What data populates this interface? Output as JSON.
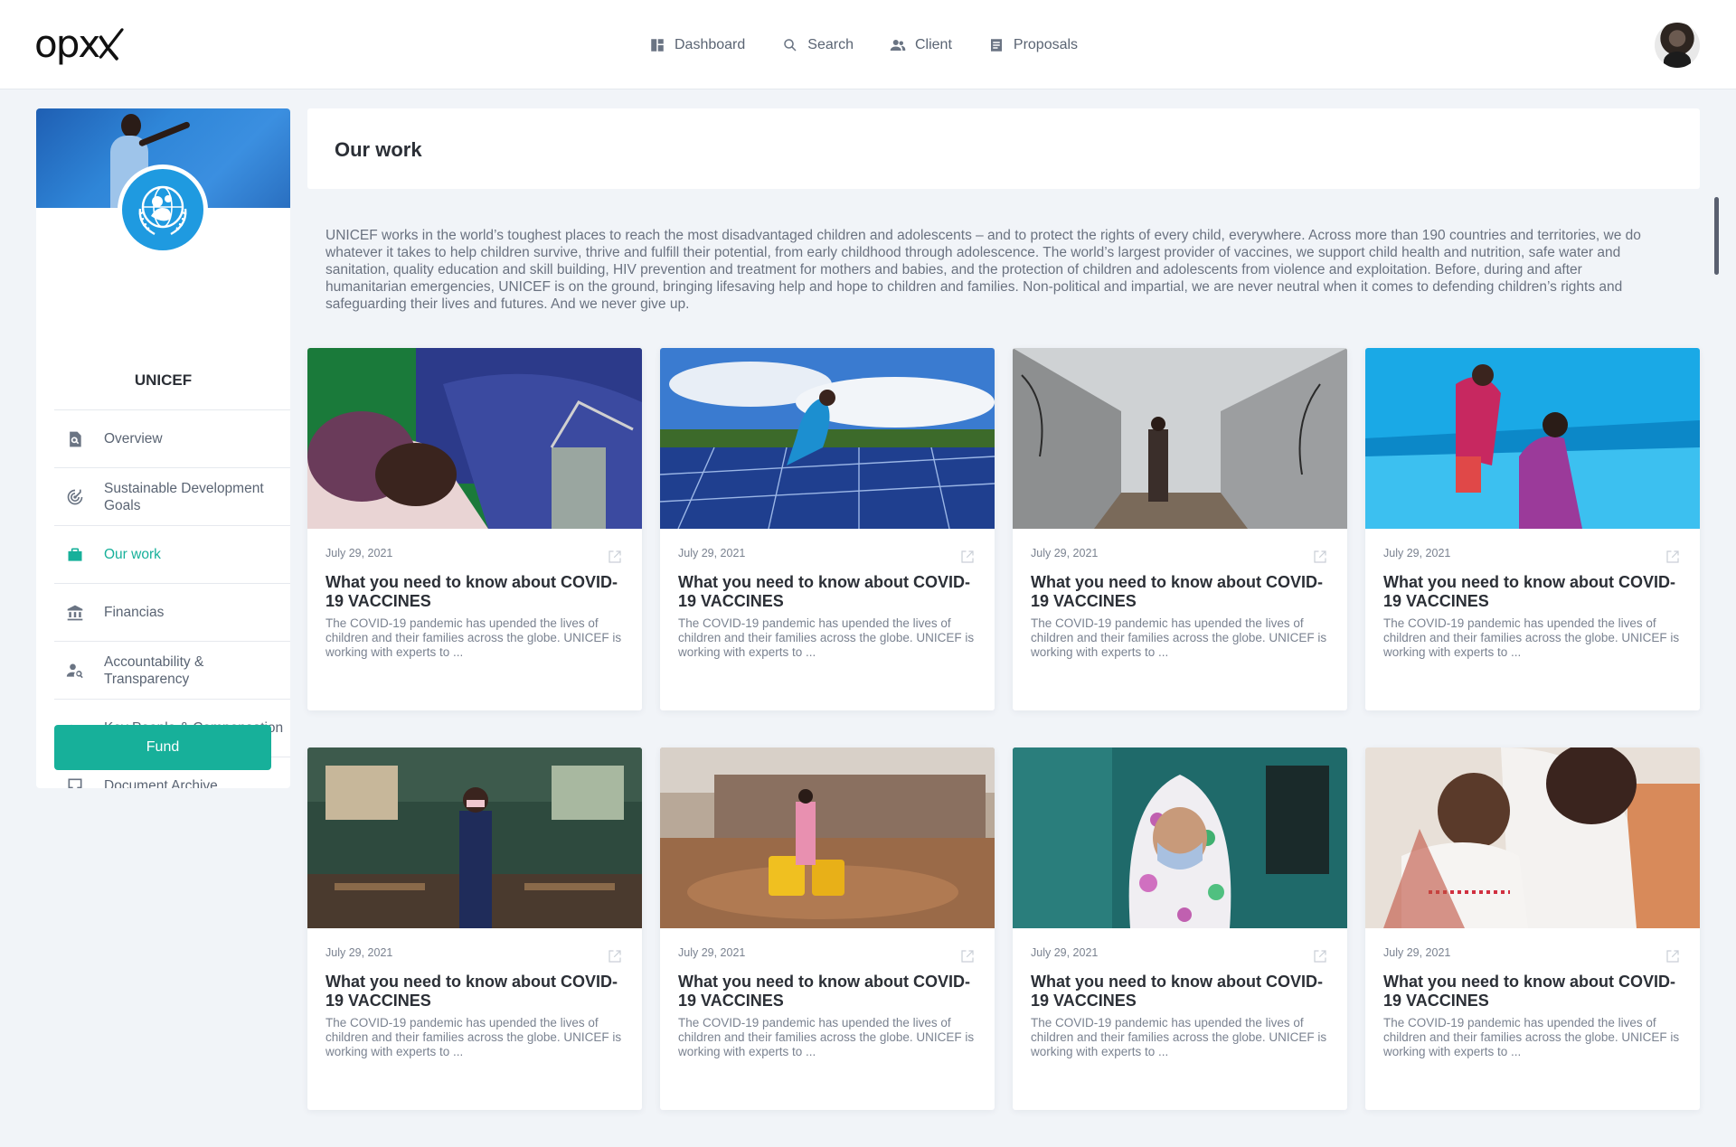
{
  "app": {
    "logo_text": "opx",
    "nav": [
      {
        "label": "Dashboard",
        "icon": "dashboard-icon"
      },
      {
        "label": "Search",
        "icon": "search-icon"
      },
      {
        "label": "Client",
        "icon": "people-icon"
      },
      {
        "label": "Proposals",
        "icon": "document-icon"
      }
    ]
  },
  "sidebar": {
    "org_name": "UNICEF",
    "items": [
      {
        "label": "Overview",
        "icon": "overview-icon",
        "active": false
      },
      {
        "label": "Sustainable Development Goals",
        "icon": "target-icon",
        "active": false
      },
      {
        "label": "Our work",
        "icon": "briefcase-icon",
        "active": true
      },
      {
        "label": "Financias",
        "icon": "bank-icon",
        "active": false
      },
      {
        "label": "Accountability & Transparency",
        "icon": "person-search-icon",
        "active": false
      },
      {
        "label": "Key People & Compensation",
        "icon": "key-icon",
        "active": false
      },
      {
        "label": "Document Archive",
        "icon": "archive-icon",
        "active": false
      }
    ],
    "fund_label": "Fund"
  },
  "main": {
    "title": "Our work",
    "description": "UNICEF works in the world’s toughest places to reach the most disadvantaged children and adolescents – and to protect the rights of every child, everywhere. Across more than 190 countries and territories, we do whatever it takes to help children survive, thrive and fulfill their potential, from early childhood through adolescence. The world’s largest provider of vaccines, we support child health and nutrition, safe water and sanitation, quality education and skill building, HIV prevention and treatment for mothers and babies, and the protection of children and adolescents from violence and exploitation. Before, during and after humanitarian emergencies, UNICEF is on the ground, bringing lifesaving help and hope to children and families. Non-political and impartial, we are never neutral when it comes to defending children’s rights and safeguarding their lives and futures. And we never give up.",
    "cards": [
      {
        "date": "July 29, 2021",
        "title": "What you need to know about COVID-19 VACCINES",
        "excerpt": "The COVID-19 pandemic has upended the lives of children and their families across the globe. UNICEF is working with experts to ..."
      },
      {
        "date": "July 29, 2021",
        "title": "What you need to know about COVID-19 VACCINES",
        "excerpt": "The COVID-19 pandemic has upended the lives of children and their families across the globe. UNICEF is working with experts to ..."
      },
      {
        "date": "July 29, 2021",
        "title": "What you need to know about COVID-19 VACCINES",
        "excerpt": "The COVID-19 pandemic has upended the lives of children and their families across the globe. UNICEF is working with experts to ..."
      },
      {
        "date": "July 29, 2021",
        "title": "What you need to know about COVID-19 VACCINES",
        "excerpt": "The COVID-19 pandemic has upended the lives of children and their families across the globe. UNICEF is working with experts to ..."
      },
      {
        "date": "July 29, 2021",
        "title": "What you need to know about COVID-19 VACCINES",
        "excerpt": "The COVID-19 pandemic has upended the lives of children and their families across the globe. UNICEF is working with experts to ..."
      },
      {
        "date": "July 29, 2021",
        "title": "What you need to know about COVID-19 VACCINES",
        "excerpt": "The COVID-19 pandemic has upended the lives of children and their families across the globe. UNICEF is working with experts to ..."
      },
      {
        "date": "July 29, 2021",
        "title": "What you need to know about COVID-19 VACCINES",
        "excerpt": "The COVID-19 pandemic has upended the lives of children and their families across the globe. UNICEF is working with experts to ..."
      },
      {
        "date": "July 29, 2021",
        "title": "What you need to know about COVID-19 VACCINES",
        "excerpt": "The COVID-19 pandemic has upended the lives of children and their families across the globe. UNICEF is working with experts to ..."
      }
    ]
  },
  "colors": {
    "accent": "#17b09a",
    "unicef_blue": "#1f9ae0",
    "background": "#f1f4f8"
  }
}
